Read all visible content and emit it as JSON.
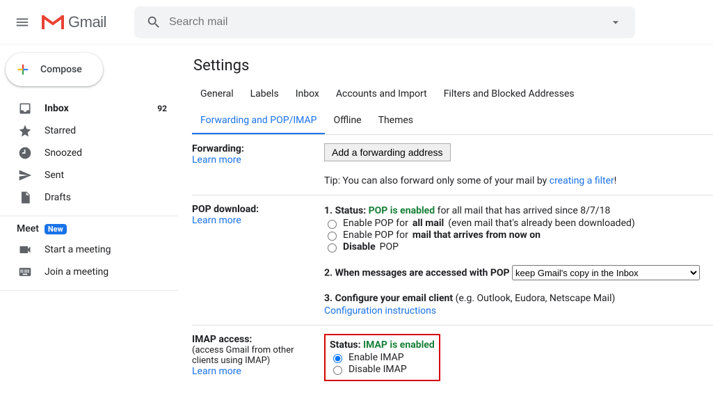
{
  "header": {
    "product_name": "Gmail",
    "search_placeholder": "Search mail"
  },
  "compose_label": "Compose",
  "sidebar": {
    "items": [
      {
        "name": "inbox",
        "label": "Inbox",
        "count": "92",
        "bold": true
      },
      {
        "name": "starred",
        "label": "Starred"
      },
      {
        "name": "snoozed",
        "label": "Snoozed"
      },
      {
        "name": "sent",
        "label": "Sent"
      },
      {
        "name": "drafts",
        "label": "Drafts"
      }
    ],
    "meet_header": "Meet",
    "meet_badge": "New",
    "meet_items": [
      {
        "name": "start-meeting",
        "label": "Start a meeting"
      },
      {
        "name": "join-meeting",
        "label": "Join a meeting"
      }
    ]
  },
  "page_title": "Settings",
  "tabs": [
    "General",
    "Labels",
    "Inbox",
    "Accounts and Import",
    "Filters and Blocked Addresses",
    "Forwarding and POP/IMAP",
    "Offline",
    "Themes"
  ],
  "active_tab": "Forwarding and POP/IMAP",
  "forwarding": {
    "label": "Forwarding:",
    "learn_more": "Learn more",
    "button": "Add a forwarding address",
    "tip_prefix": "Tip: You can also forward only some of your mail by ",
    "tip_link": "creating a filter",
    "tip_suffix": "!"
  },
  "pop": {
    "label": "POP download:",
    "learn_more": "Learn more",
    "status_num": "1. Status: ",
    "status_text": "POP is enabled",
    "status_tail": " for all mail that has arrived since 8/7/18",
    "opt1_a": "Enable POP for ",
    "opt1_b": "all mail",
    "opt1_c": " (even mail that's already been downloaded)",
    "opt2_a": "Enable POP for ",
    "opt2_b": "mail that arrives from now on",
    "opt3_a": "Disable",
    "opt3_b": " POP",
    "access_label": "2. When messages are accessed with POP",
    "access_selected": "keep Gmail's copy in the Inbox",
    "configure_label": "3. Configure your email client",
    "configure_tail": " (e.g. Outlook, Eudora, Netscape Mail)",
    "configure_link": "Configuration instructions"
  },
  "imap": {
    "label": "IMAP access:",
    "sub": "(access Gmail from other clients using IMAP)",
    "learn_more": "Learn more",
    "status_prefix": "Status: ",
    "status_text": "IMAP is enabled",
    "opt_enable": "Enable IMAP",
    "opt_disable": "Disable IMAP"
  }
}
